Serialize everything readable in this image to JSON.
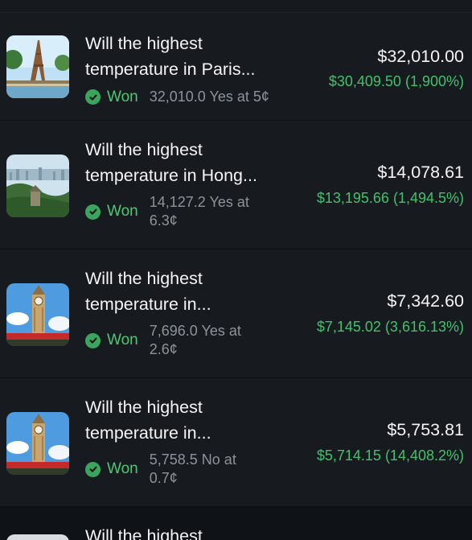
{
  "positions": [
    {
      "title_line1": "Will the highest",
      "title_line2": "temperature in Paris...",
      "status": "Won",
      "shares": "32,010.0 Yes at 5¢",
      "value": "$32,010.00",
      "pnl": "$30,409.50 (1,900%)",
      "image": "eiffel-tower"
    },
    {
      "title_line1": "Will the highest",
      "title_line2": "temperature in Hong...",
      "status": "Won",
      "shares": "14,127.2 Yes at 6.3¢",
      "value": "$14,078.61",
      "pnl": "$13,195.66 (1,494.5%)",
      "image": "hong-kong-skyline"
    },
    {
      "title_line1": "Will the highest",
      "title_line2": "temperature in...",
      "status": "Won",
      "shares": "7,696.0 Yes at 2.6¢",
      "value": "$7,342.60",
      "pnl": "$7,145.02 (3,616.13%)",
      "image": "big-ben"
    },
    {
      "title_line1": "Will the highest",
      "title_line2": "temperature in...",
      "status": "Won",
      "shares": "5,758.5 No at 0.7¢",
      "value": "$5,753.81",
      "pnl": "$5,714.15 (14,408.2%)",
      "image": "big-ben"
    },
    {
      "title_line1": "Will the highest"
    }
  ],
  "colors": {
    "background": "#171b20",
    "won_green": "#4cc86e",
    "pnl_green": "#44c06a",
    "muted": "#8c939b"
  }
}
